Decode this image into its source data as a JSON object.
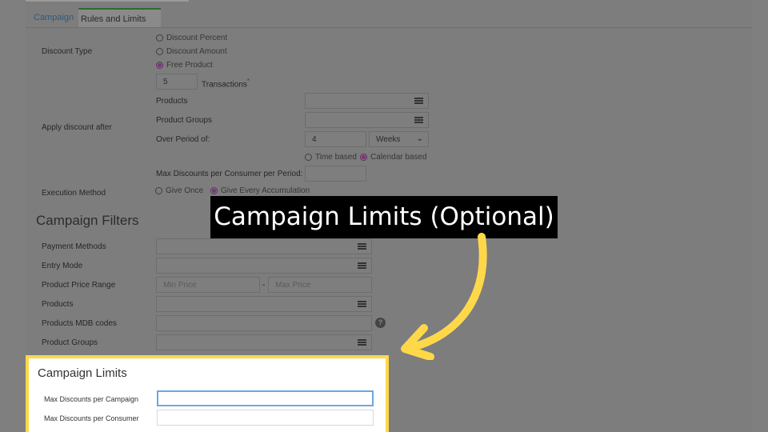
{
  "tabs": [
    {
      "label": "Campaign"
    },
    {
      "label": "Rules and Limits"
    }
  ],
  "rules": {
    "discount_type": {
      "label": "Discount Type",
      "options": [
        "Discount Percent",
        "Discount Amount",
        "Free Product"
      ],
      "selected": "Free Product"
    },
    "transactions": {
      "value": "5",
      "label": "Transactions",
      "required_mark": "*"
    },
    "apply_after": {
      "label": "Apply discount after",
      "products_label": "Products",
      "product_groups_label": "Product Groups",
      "period_label": "Over Period of:",
      "period_value": "4",
      "period_unit": "Weeks",
      "basis_options": [
        "Time based",
        "Calendar based"
      ],
      "basis_selected": "Calendar based",
      "max_per_consumer_label": "Max Discounts per Consumer per Period:"
    },
    "execution": {
      "label": "Execution Method",
      "options": [
        "Give Once",
        "Give Every Accumulation"
      ],
      "selected": "Give Every Accumulation"
    }
  },
  "filters": {
    "title": "Campaign Filters",
    "payment_methods": "Payment Methods",
    "entry_mode": "Entry Mode",
    "price_range": "Product Price Range",
    "min_price_placeholder": "Min Price",
    "range_sep": "-",
    "max_price_placeholder": "Max Price",
    "products": "Products",
    "mdb_codes": "Products MDB codes",
    "product_groups": "Product Groups"
  },
  "limits": {
    "title": "Campaign Limits",
    "max_per_campaign": "Max Discounts per Campaign",
    "max_per_consumer": "Max Discounts per Consumer"
  },
  "callout": {
    "text": "Campaign Limits (Optional)",
    "arrow_color": "#FFD84A"
  },
  "colors": {
    "highlight": "#FFD84A",
    "callout_bg": "#000000",
    "focus_border": "#6CA8E0",
    "radio_selected": "#7C347C"
  }
}
